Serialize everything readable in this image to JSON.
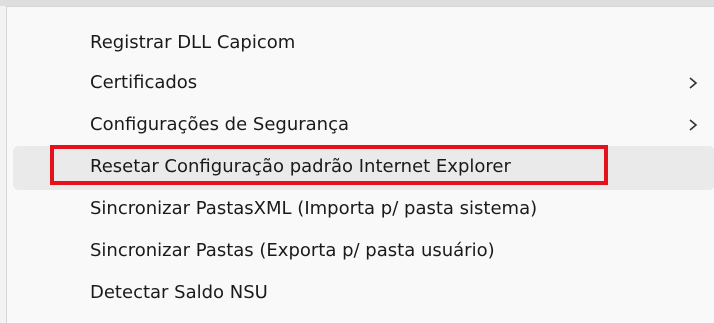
{
  "menu": {
    "items": [
      {
        "label": "Registrar DLL Capicom",
        "has_submenu": false
      },
      {
        "label": "Certificados",
        "has_submenu": true,
        "submenu_icon": "chevron-right-icon"
      },
      {
        "label": "Configurações de Segurança",
        "has_submenu": true,
        "submenu_icon": "chevron-right-icon"
      },
      {
        "label": "Resetar Configuração padrão Internet Explorer",
        "has_submenu": false,
        "highlighted": true
      },
      {
        "label": "Sincronizar PastasXML (Importa p/ pasta sistema)",
        "has_submenu": false
      },
      {
        "label": "Sincronizar Pastas (Exporta p/ pasta usuário)",
        "has_submenu": false
      },
      {
        "label": "Detectar Saldo NSU",
        "has_submenu": false
      }
    ]
  },
  "colors": {
    "highlight_border": "#e3121b",
    "hover_background": "#eaeaea",
    "menu_background": "#f9f9f9",
    "text": "#1a1a1a"
  }
}
